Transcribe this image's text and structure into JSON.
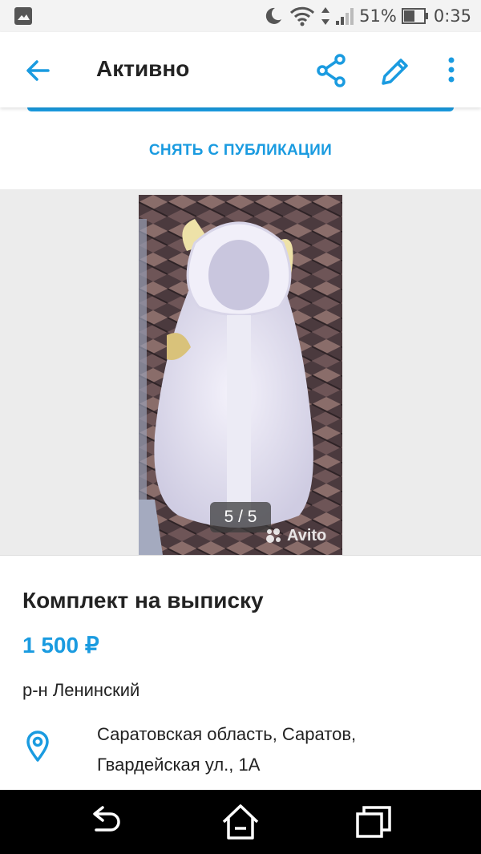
{
  "status_bar": {
    "battery_percent": "51%",
    "time": "0:35"
  },
  "app_bar": {
    "title": "Активно",
    "back_icon": "arrow-left-icon",
    "share_icon": "share-icon",
    "edit_icon": "pencil-icon",
    "more_icon": "more-vertical-icon"
  },
  "actions": {
    "unpublish_label": "СНЯТЬ С ПУБЛИКАЦИИ"
  },
  "gallery": {
    "counter": "5 / 5",
    "watermark": "Avito"
  },
  "listing": {
    "title": "Комплект на выписку",
    "price": "1 500 ₽",
    "district": "р-н Ленинский",
    "address_line1": "Саратовская область, Саратов,",
    "address_line2": "Гвардейская ул., 1А"
  },
  "nav_bar": {
    "back_icon": "nav-back-icon",
    "home_icon": "nav-home-icon",
    "recents_icon": "nav-recents-icon"
  },
  "colors": {
    "accent": "#1a9be0",
    "text": "#222222",
    "gallery_bg": "#ececec",
    "status_bar_bg": "#f3f3f3",
    "nav_bar_bg": "#000000"
  }
}
